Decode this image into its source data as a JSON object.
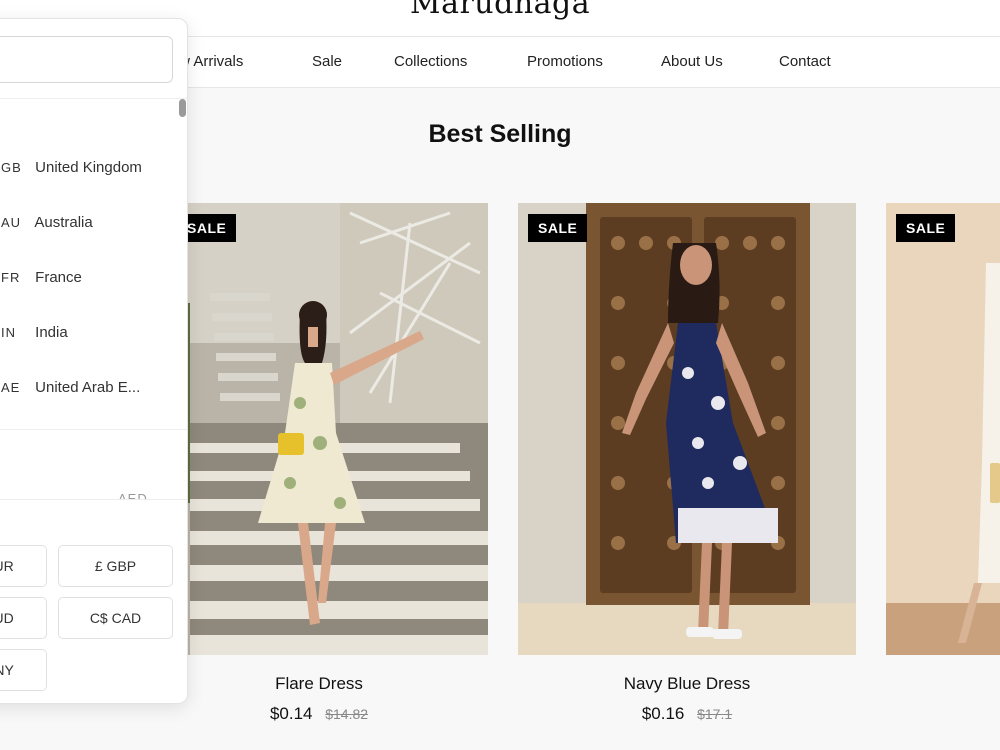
{
  "header": {
    "brand": "Marudhaga",
    "nav": [
      "New Arrivals",
      "Sale",
      "Collections",
      "Promotions",
      "About Us",
      "Contact"
    ]
  },
  "section": {
    "title": "Best Selling"
  },
  "products": [
    {
      "badge": "SALE",
      "name": "Flare Dress",
      "price": "$0.14",
      "old_price": "$14.82"
    },
    {
      "badge": "SALE",
      "name": "Navy Blue Dress",
      "price": "$0.16",
      "old_price": "$17.1"
    },
    {
      "badge": "SALE",
      "name": "",
      "price": "",
      "old_price": ""
    }
  ],
  "popup": {
    "countries": [
      {
        "code": "GB",
        "name": "United Kingdom"
      },
      {
        "code": "AU",
        "name": "Australia"
      },
      {
        "code": "FR",
        "name": "France"
      },
      {
        "code": "IN",
        "name": "India"
      },
      {
        "code": "AE",
        "name": "United Arab E..."
      }
    ],
    "aed_hint": "AED",
    "currencies": [
      {
        "label": "EUR"
      },
      {
        "label": "£  GBP"
      },
      {
        "label": "AUD"
      },
      {
        "label": "C$  CAD"
      },
      {
        "label": "CNY"
      }
    ]
  },
  "colors": {
    "badge_bg": "#000000",
    "accent": "#111111"
  }
}
